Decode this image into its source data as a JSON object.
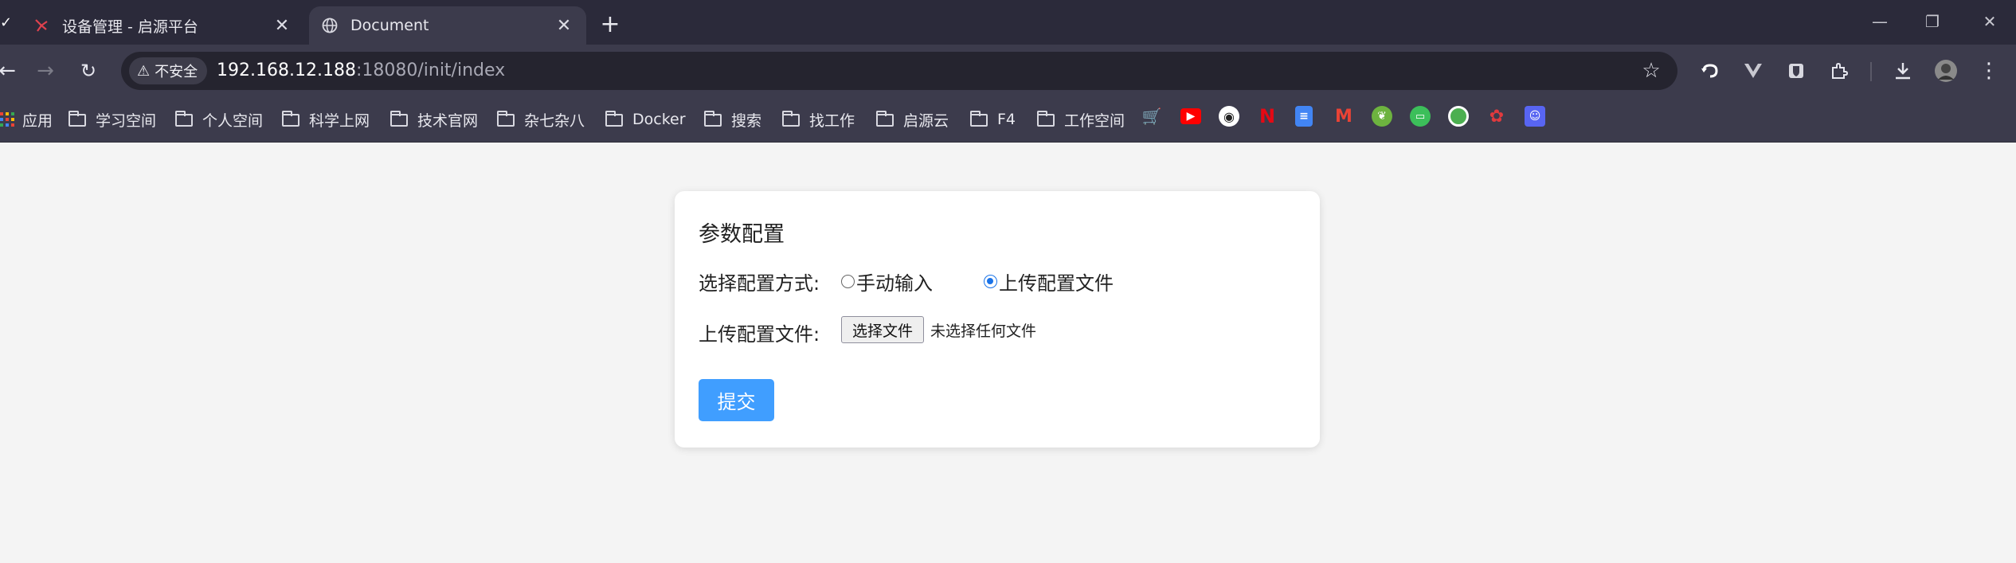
{
  "browser": {
    "tabs": [
      {
        "title": "设备管理 - 启源平台",
        "active": false,
        "icon": "spider-favicon-icon"
      },
      {
        "title": "Document",
        "active": true,
        "icon": "globe-icon"
      }
    ],
    "security_label": "不安全",
    "url_host": "192.168.12.188",
    "url_rest": ":18080/init/index",
    "bookmarks": [
      {
        "label": "应用",
        "icon": "apps-grid-icon"
      },
      {
        "label": "学习空间",
        "icon": "folder-icon"
      },
      {
        "label": "个人空间",
        "icon": "folder-icon"
      },
      {
        "label": "科学上网",
        "icon": "folder-icon"
      },
      {
        "label": "技术官网",
        "icon": "folder-icon"
      },
      {
        "label": "杂七杂八",
        "icon": "folder-icon"
      },
      {
        "label": "Docker",
        "icon": "folder-icon"
      },
      {
        "label": "搜索",
        "icon": "folder-icon"
      },
      {
        "label": "找工作",
        "icon": "folder-icon"
      },
      {
        "label": "启源云",
        "icon": "folder-icon"
      },
      {
        "label": "F4",
        "icon": "folder-icon"
      },
      {
        "label": "工作空间",
        "icon": "folder-icon"
      }
    ],
    "bookmark_icons": [
      "shopping-cart-icon",
      "youtube-icon",
      "github-icon",
      "netflix-icon",
      "google-docs-icon",
      "gmail-icon",
      "spring-icon",
      "bilibili-icon",
      "android-icon",
      "huawei-icon",
      "discord-icon"
    ]
  },
  "form": {
    "title": "参数配置",
    "config_method_label": "选择配置方式:",
    "options": [
      {
        "label": "手动输入",
        "checked": false
      },
      {
        "label": "上传配置文件",
        "checked": true
      }
    ],
    "upload_label": "上传配置文件:",
    "file_button_label": "选择文件",
    "file_status": "未选择任何文件",
    "submit_label": "提交"
  },
  "colors": {
    "accent": "#409eff",
    "radio_checked": "#1a73e8",
    "page_bg": "#f4f4f4",
    "chrome_bg": "#2b2a3a"
  }
}
